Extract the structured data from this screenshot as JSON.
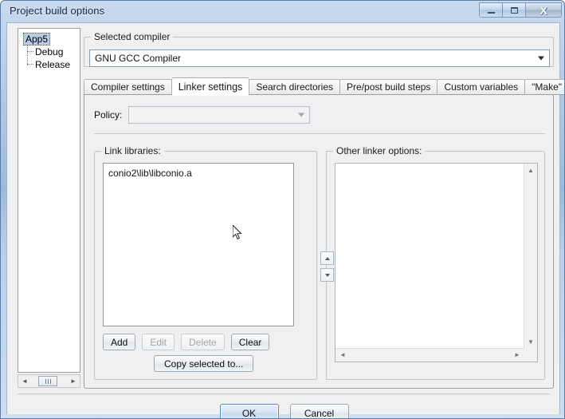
{
  "window": {
    "title": "Project build options",
    "caption_buttons": [
      {
        "name": "minimize",
        "glyph": "minimize-icon"
      },
      {
        "name": "maximize",
        "glyph": "maximize-icon"
      },
      {
        "name": "close",
        "glyph": "close-icon",
        "label": "X"
      }
    ]
  },
  "tree": {
    "root": "App5",
    "children": [
      "Debug",
      "Release"
    ],
    "scroll": {
      "left_arrow": "◄",
      "right_arrow": "►"
    }
  },
  "compiler": {
    "group_title": "Selected compiler",
    "selected": "GNU GCC Compiler",
    "options": [
      "GNU GCC Compiler"
    ]
  },
  "tabs": [
    {
      "label": "Compiler settings",
      "active": false
    },
    {
      "label": "Linker settings",
      "active": true
    },
    {
      "label": "Search directories",
      "active": false
    },
    {
      "label": "Pre/post build steps",
      "active": false
    },
    {
      "label": "Custom variables",
      "active": false
    },
    {
      "label": "\"Make\" commands",
      "active": false
    }
  ],
  "policy": {
    "label": "Policy:",
    "value": "",
    "placeholder": ""
  },
  "link_libraries": {
    "group_title": "Link libraries:",
    "items": [
      "conio2\\lib\\libconio.a"
    ],
    "buttons": [
      {
        "label": "Add",
        "enabled": true
      },
      {
        "label": "Edit",
        "enabled": false
      },
      {
        "label": "Delete",
        "enabled": false
      },
      {
        "label": "Clear",
        "enabled": true
      }
    ],
    "copy_button": "Copy selected to..."
  },
  "reorder": {
    "move_up": "▲",
    "move_down": "▼"
  },
  "other_linker_options": {
    "group_title": "Other linker options:",
    "value": "",
    "scroll": {
      "up_arrow": "▲",
      "down_arrow": "▼",
      "left_arrow": "◄",
      "right_arrow": "►"
    }
  },
  "footer": {
    "ok_label": "OK",
    "cancel_label": "Cancel"
  },
  "colors": {
    "titlebar_accent": "#9cbade",
    "selection": "#b8cce4",
    "dialog_bg": "#f0f0f0",
    "focus_border": "#5a8bc2"
  }
}
